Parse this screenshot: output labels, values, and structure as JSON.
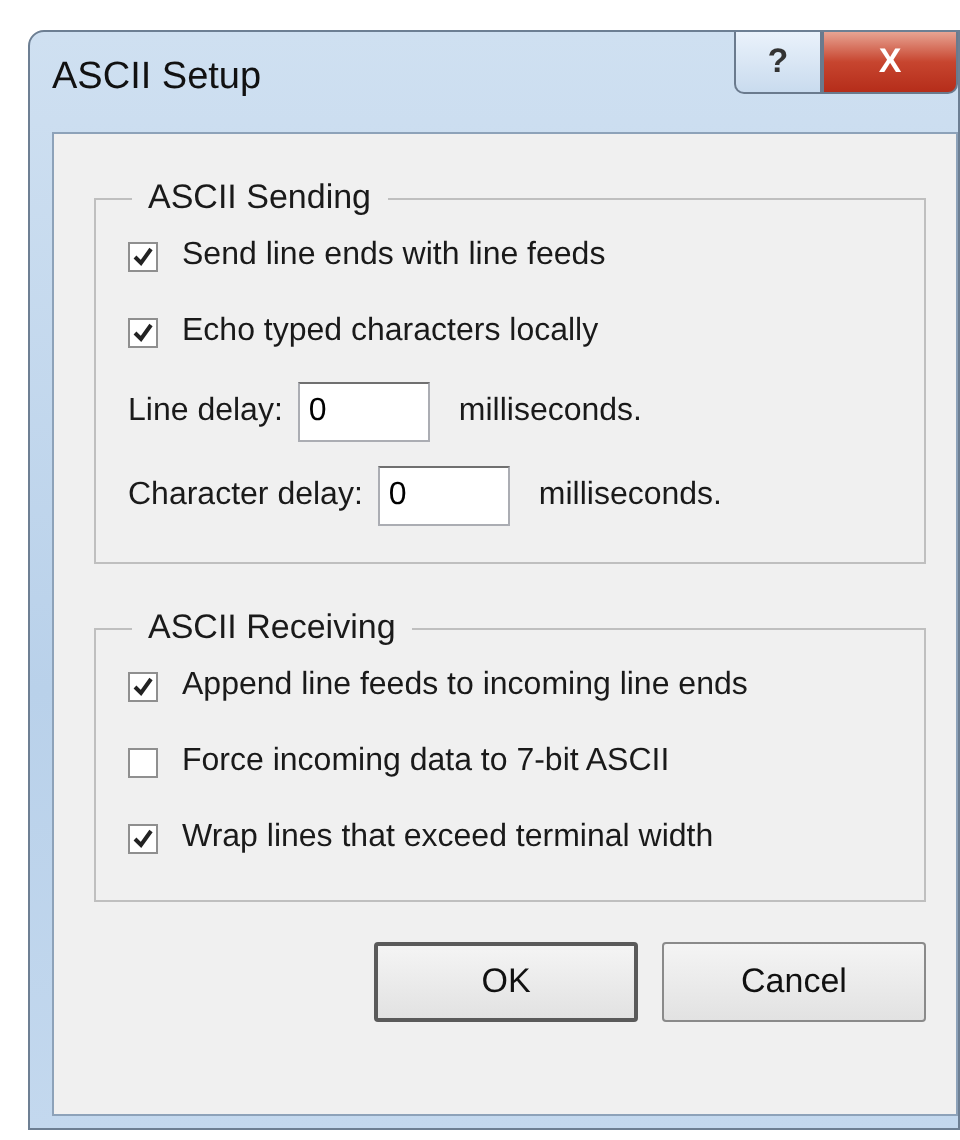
{
  "window": {
    "title": "ASCII Setup",
    "help_button": "?",
    "close_button": "X"
  },
  "groups": [
    {
      "title": "ASCII Sending",
      "items": [
        {
          "kind": "checkbox",
          "label": "Send line ends with line feeds",
          "checked": true
        },
        {
          "kind": "checkbox",
          "label": "Echo typed characters locally",
          "checked": true
        },
        {
          "kind": "field",
          "label": "Line delay:",
          "value": "0",
          "unit": "milliseconds."
        },
        {
          "kind": "field",
          "label": "Character delay:",
          "value": "0",
          "unit": "milliseconds."
        }
      ]
    },
    {
      "title": "ASCII Receiving",
      "items": [
        {
          "kind": "checkbox",
          "label": "Append line feeds to incoming line ends",
          "checked": true
        },
        {
          "kind": "checkbox",
          "label": "Force incoming data to 7-bit ASCII",
          "checked": false
        },
        {
          "kind": "checkbox",
          "label": "Wrap lines that exceed terminal width",
          "checked": true
        }
      ]
    }
  ],
  "buttons": [
    {
      "label": "OK",
      "default": true
    },
    {
      "label": "Cancel",
      "default": false
    }
  ]
}
